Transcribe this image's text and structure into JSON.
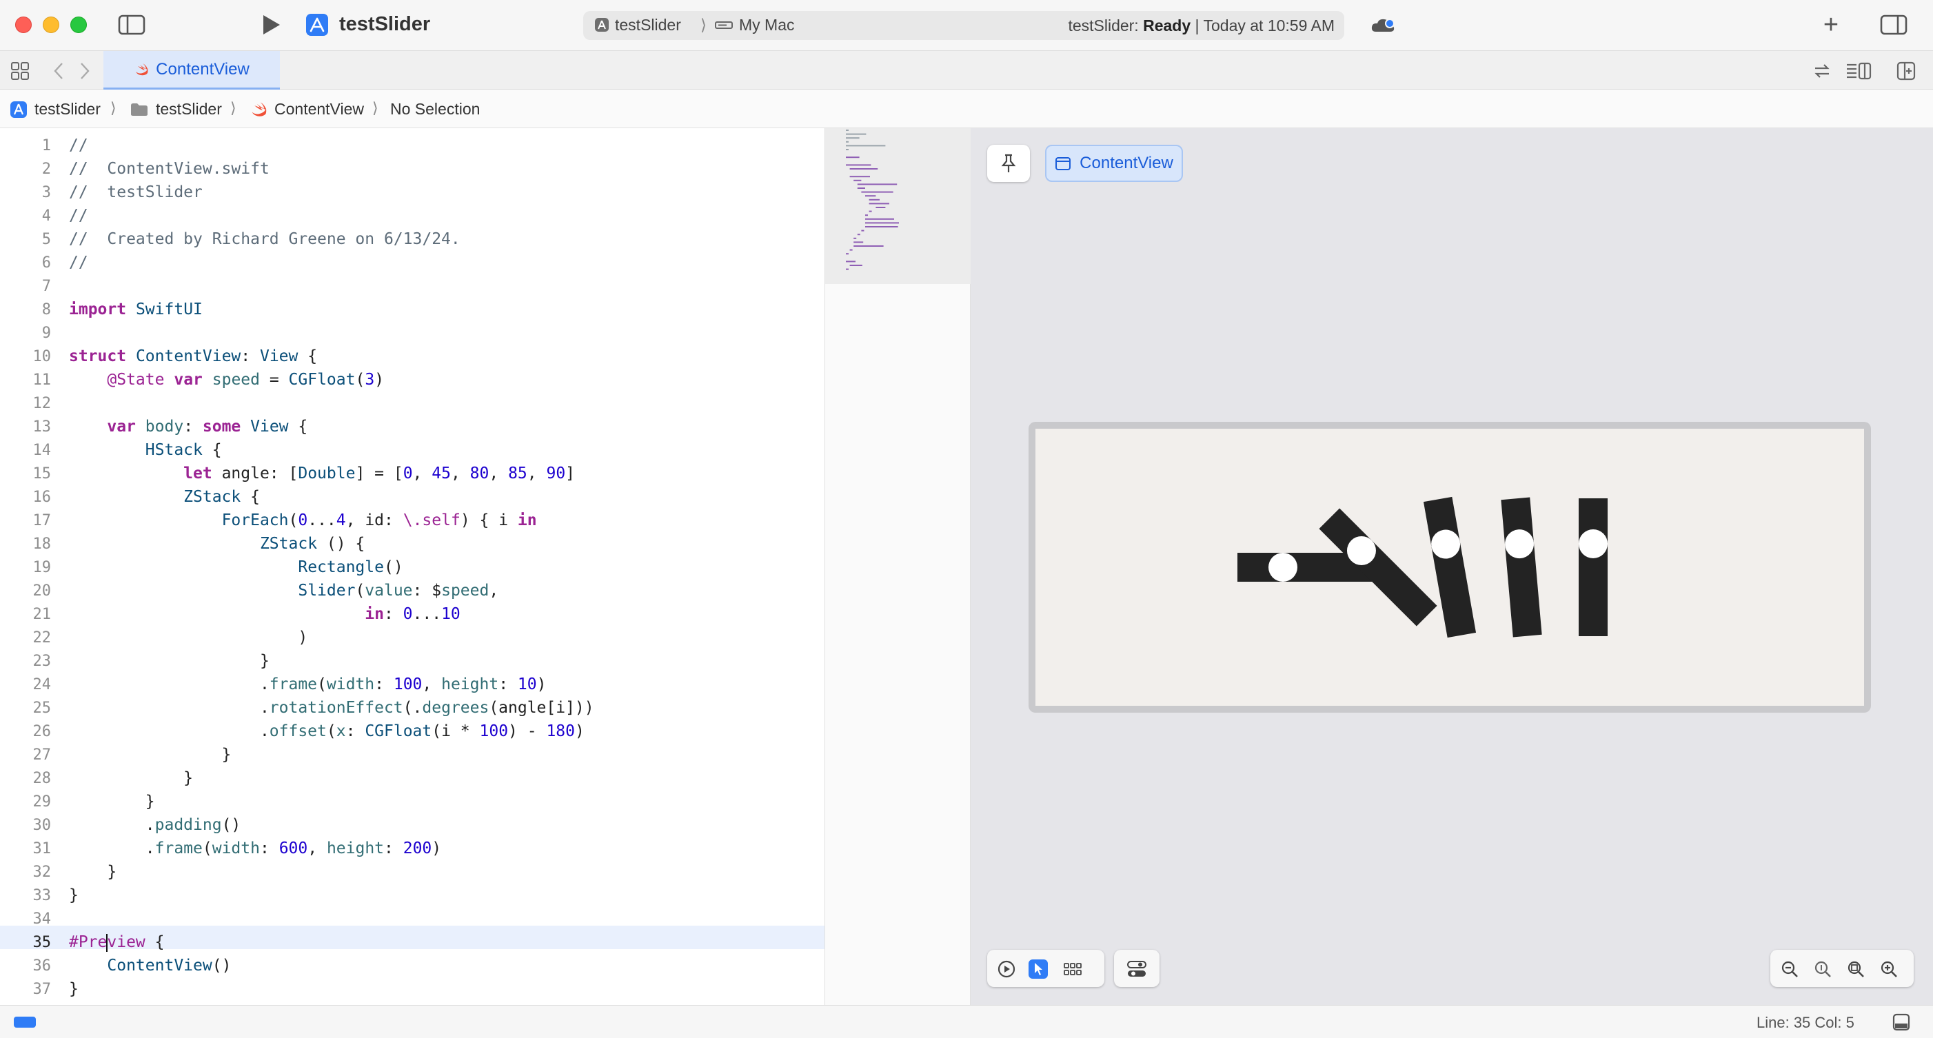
{
  "toolbar": {
    "project_title": "testSlider",
    "scheme_target": "testSlider",
    "scheme_sep": "⟩",
    "scheme_destination": "My Mac",
    "status_prefix": "testSlider:",
    "status_state": "Ready",
    "status_time": "| Today at 10:59 AM",
    "add_label": "+"
  },
  "tabbar": {
    "active_tab": "ContentView"
  },
  "jumpbar": {
    "project": "testSlider",
    "sep": "⟩",
    "group": "testSlider",
    "file": "ContentView",
    "selection": "No Selection"
  },
  "editor": {
    "active_line_number": "35",
    "lines": [
      {
        "n": "1",
        "text": "//"
      },
      {
        "n": "2",
        "text": "//  ContentView.swift"
      },
      {
        "n": "3",
        "text": "//  testSlider"
      },
      {
        "n": "4",
        "text": "//"
      },
      {
        "n": "5",
        "text": "//  Created by Richard Greene on 6/13/24."
      },
      {
        "n": "6",
        "text": "//"
      },
      {
        "n": "7",
        "text": ""
      },
      {
        "n": "8",
        "text": "import SwiftUI"
      },
      {
        "n": "9",
        "text": ""
      },
      {
        "n": "10",
        "text": "struct ContentView: View {"
      },
      {
        "n": "11",
        "text": "    @State var speed = CGFloat(3)"
      },
      {
        "n": "12",
        "text": ""
      },
      {
        "n": "13",
        "text": "    var body: some View {"
      },
      {
        "n": "14",
        "text": "        HStack {"
      },
      {
        "n": "15",
        "text": "            let angle: [Double] = [0, 45, 80, 85, 90]"
      },
      {
        "n": "16",
        "text": "            ZStack {"
      },
      {
        "n": "17",
        "text": "                ForEach(0...4, id: \\.self) { i in"
      },
      {
        "n": "18",
        "text": "                    ZStack () {"
      },
      {
        "n": "19",
        "text": "                        Rectangle()"
      },
      {
        "n": "20",
        "text": "                        Slider(value: $speed,"
      },
      {
        "n": "21",
        "text": "                               in: 0...10"
      },
      {
        "n": "22",
        "text": "                        )"
      },
      {
        "n": "23",
        "text": "                    }"
      },
      {
        "n": "24",
        "text": "                    .frame(width: 100, height: 10)"
      },
      {
        "n": "25",
        "text": "                    .rotationEffect(.degrees(angle[i]))"
      },
      {
        "n": "26",
        "text": "                    .offset(x: CGFloat(i * 100) - 180)"
      },
      {
        "n": "27",
        "text": "                }"
      },
      {
        "n": "28",
        "text": "            }"
      },
      {
        "n": "29",
        "text": "        }"
      },
      {
        "n": "30",
        "text": "        .padding()"
      },
      {
        "n": "31",
        "text": "        .frame(width: 600, height: 200)"
      },
      {
        "n": "32",
        "text": "    }"
      },
      {
        "n": "33",
        "text": "}"
      },
      {
        "n": "34",
        "text": ""
      },
      {
        "n": "35",
        "text": "#Preview {"
      },
      {
        "n": "36",
        "text": "    ContentView()"
      },
      {
        "n": "37",
        "text": "}"
      }
    ]
  },
  "preview": {
    "chip_label": "ContentView",
    "slider_angles_deg": [
      0,
      45,
      80,
      85,
      90
    ],
    "slider_value": 3,
    "slider_range": [
      0,
      10
    ],
    "bar_color": "#232323",
    "knob_color": "#ffffff"
  },
  "statusbar": {
    "cursor_position": "Line: 35  Col: 5"
  },
  "syntax_colors": {
    "keyword": "#9b2393",
    "type": "#0b4f79",
    "number": "#1c00cf",
    "comment": "#5d6c79",
    "function": "#326d74",
    "default": "#222222"
  }
}
